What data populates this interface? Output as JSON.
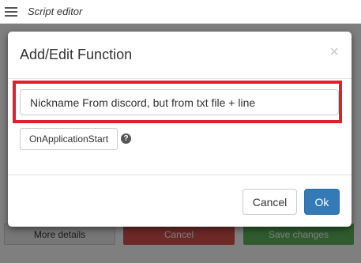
{
  "app": {
    "title": "Script editor"
  },
  "page": {
    "more_details_label": "More details",
    "cancel_label": "Cancel",
    "save_label": "Save changes"
  },
  "modal": {
    "title": "Add/Edit Function",
    "close_glyph": "×",
    "function_name_value": "Nickname From discord, but from txt file + line",
    "event_label": "OnApplicationStart",
    "help_glyph": "?",
    "cancel_label": "Cancel",
    "ok_label": "Ok"
  },
  "colors": {
    "highlight": "#e0202a",
    "primary": "#337ab7",
    "danger": "#d9534f",
    "success": "#5cb85c"
  }
}
